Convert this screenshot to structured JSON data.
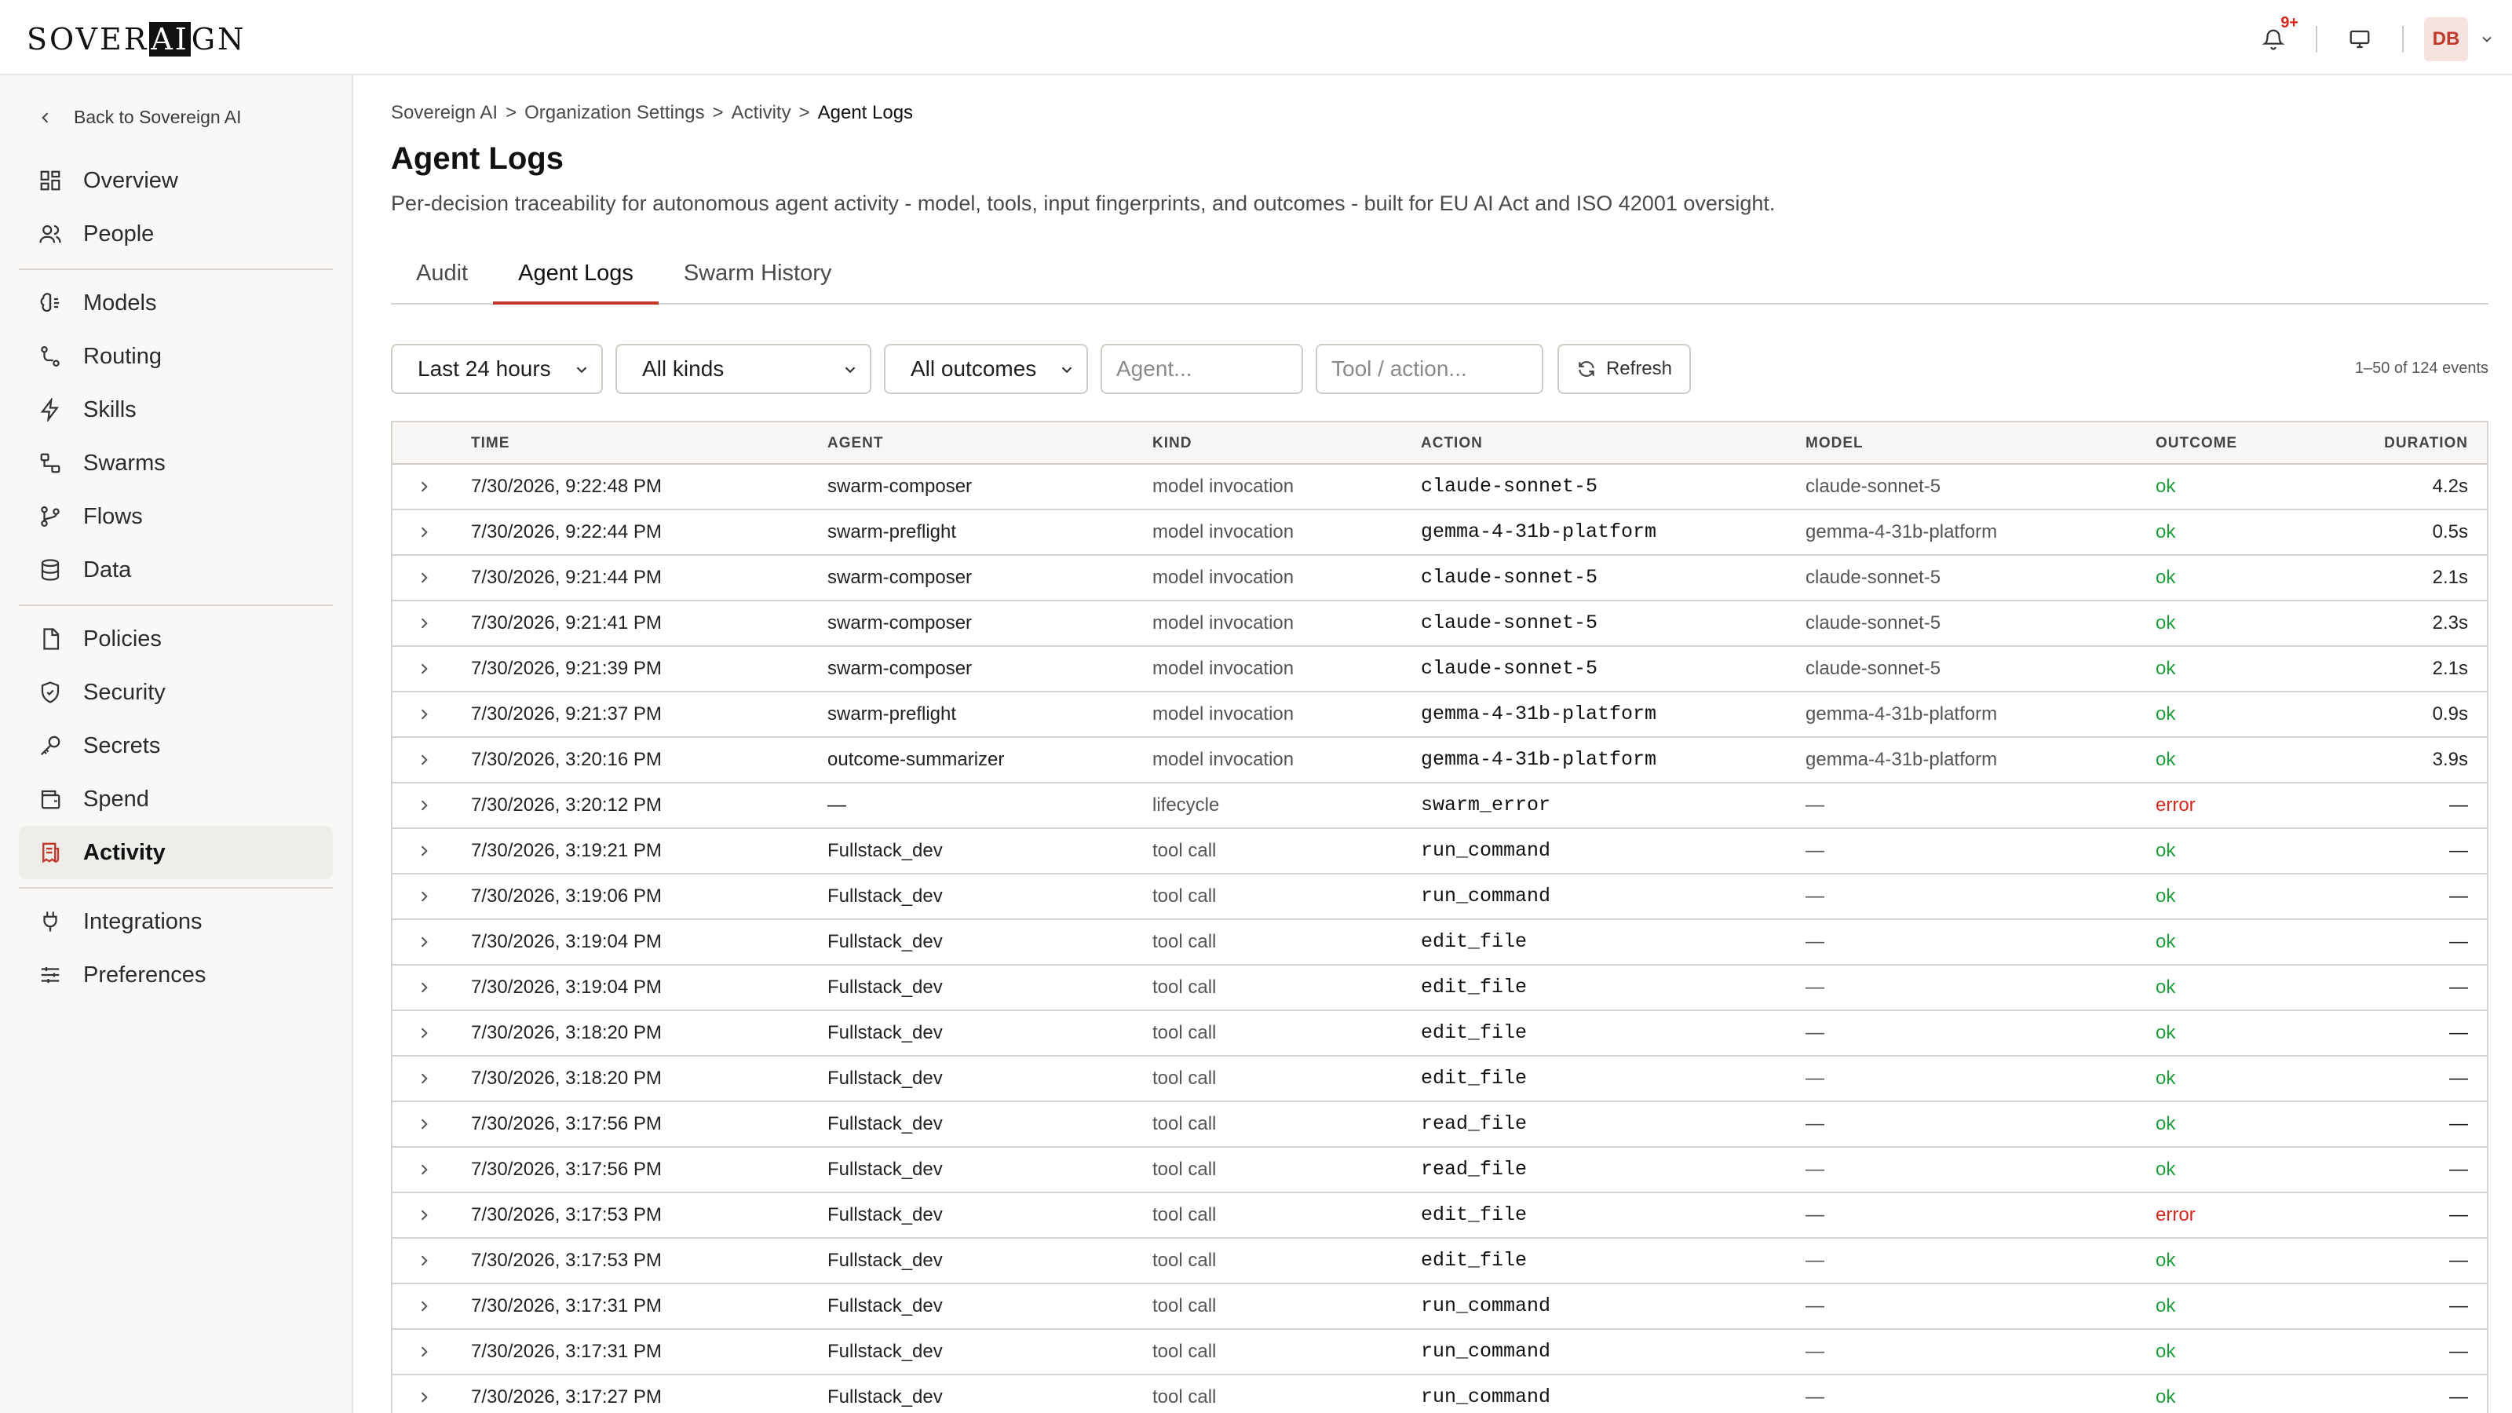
{
  "brand": {
    "logo_pre": "SOVER",
    "logo_hl": "AI",
    "logo_post": "GN"
  },
  "topbar": {
    "notifications_badge": "9+",
    "avatar_initials": "DB"
  },
  "sidebar": {
    "back_label": "Back to Sovereign AI",
    "groups": [
      [
        {
          "label": "Overview",
          "icon": "grid-icon"
        },
        {
          "label": "People",
          "icon": "people-icon"
        }
      ],
      [
        {
          "label": "Models",
          "icon": "brain-icon"
        },
        {
          "label": "Routing",
          "icon": "route-icon"
        },
        {
          "label": "Skills",
          "icon": "bolt-icon"
        },
        {
          "label": "Swarms",
          "icon": "swarm-icon"
        },
        {
          "label": "Flows",
          "icon": "flow-icon"
        },
        {
          "label": "Data",
          "icon": "database-icon"
        }
      ],
      [
        {
          "label": "Policies",
          "icon": "document-icon"
        },
        {
          "label": "Security",
          "icon": "shield-icon"
        },
        {
          "label": "Secrets",
          "icon": "key-icon"
        },
        {
          "label": "Spend",
          "icon": "wallet-icon"
        },
        {
          "label": "Activity",
          "icon": "receipt-icon",
          "active": true
        }
      ],
      [
        {
          "label": "Integrations",
          "icon": "plug-icon"
        },
        {
          "label": "Preferences",
          "icon": "sliders-icon"
        }
      ]
    ]
  },
  "breadcrumb": {
    "items": [
      "Sovereign AI",
      "Organization Settings",
      "Activity"
    ],
    "separator": ">",
    "current": "Agent Logs"
  },
  "page": {
    "title": "Agent Logs",
    "description": "Per-decision traceability for autonomous agent activity - model, tools, input fingerprints, and outcomes - built for EU AI Act and ISO 42001 oversight."
  },
  "tabs": [
    {
      "label": "Audit"
    },
    {
      "label": "Agent Logs",
      "active": true
    },
    {
      "label": "Swarm History"
    }
  ],
  "filters": {
    "time_range": "Last 24 hours",
    "kind": "All kinds",
    "outcome": "All outcomes",
    "agent_placeholder": "Agent...",
    "tool_placeholder": "Tool / action...",
    "refresh_label": "Refresh",
    "count_text": "1–50 of 124 events"
  },
  "table": {
    "columns": [
      "TIME",
      "AGENT",
      "KIND",
      "ACTION",
      "MODEL",
      "OUTCOME",
      "DURATION"
    ],
    "rows": [
      {
        "time": "7/30/2026, 9:22:48 PM",
        "agent": "swarm-composer",
        "kind": "model invocation",
        "action": "claude-sonnet-5",
        "model": "claude-sonnet-5",
        "outcome": "ok",
        "duration": "4.2s"
      },
      {
        "time": "7/30/2026, 9:22:44 PM",
        "agent": "swarm-preflight",
        "kind": "model invocation",
        "action": "gemma-4-31b-platform",
        "model": "gemma-4-31b-platform",
        "outcome": "ok",
        "duration": "0.5s"
      },
      {
        "time": "7/30/2026, 9:21:44 PM",
        "agent": "swarm-composer",
        "kind": "model invocation",
        "action": "claude-sonnet-5",
        "model": "claude-sonnet-5",
        "outcome": "ok",
        "duration": "2.1s"
      },
      {
        "time": "7/30/2026, 9:21:41 PM",
        "agent": "swarm-composer",
        "kind": "model invocation",
        "action": "claude-sonnet-5",
        "model": "claude-sonnet-5",
        "outcome": "ok",
        "duration": "2.3s"
      },
      {
        "time": "7/30/2026, 9:21:39 PM",
        "agent": "swarm-composer",
        "kind": "model invocation",
        "action": "claude-sonnet-5",
        "model": "claude-sonnet-5",
        "outcome": "ok",
        "duration": "2.1s"
      },
      {
        "time": "7/30/2026, 9:21:37 PM",
        "agent": "swarm-preflight",
        "kind": "model invocation",
        "action": "gemma-4-31b-platform",
        "model": "gemma-4-31b-platform",
        "outcome": "ok",
        "duration": "0.9s"
      },
      {
        "time": "7/30/2026, 3:20:16 PM",
        "agent": "outcome-summarizer",
        "kind": "model invocation",
        "action": "gemma-4-31b-platform",
        "model": "gemma-4-31b-platform",
        "outcome": "ok",
        "duration": "3.9s"
      },
      {
        "time": "7/30/2026, 3:20:12 PM",
        "agent": "—",
        "kind": "lifecycle",
        "action": "swarm_error",
        "model": "—",
        "outcome": "error",
        "duration": "—"
      },
      {
        "time": "7/30/2026, 3:19:21 PM",
        "agent": "Fullstack_dev",
        "kind": "tool call",
        "action": "run_command",
        "model": "—",
        "outcome": "ok",
        "duration": "—"
      },
      {
        "time": "7/30/2026, 3:19:06 PM",
        "agent": "Fullstack_dev",
        "kind": "tool call",
        "action": "run_command",
        "model": "—",
        "outcome": "ok",
        "duration": "—"
      },
      {
        "time": "7/30/2026, 3:19:04 PM",
        "agent": "Fullstack_dev",
        "kind": "tool call",
        "action": "edit_file",
        "model": "—",
        "outcome": "ok",
        "duration": "—"
      },
      {
        "time": "7/30/2026, 3:19:04 PM",
        "agent": "Fullstack_dev",
        "kind": "tool call",
        "action": "edit_file",
        "model": "—",
        "outcome": "ok",
        "duration": "—"
      },
      {
        "time": "7/30/2026, 3:18:20 PM",
        "agent": "Fullstack_dev",
        "kind": "tool call",
        "action": "edit_file",
        "model": "—",
        "outcome": "ok",
        "duration": "—"
      },
      {
        "time": "7/30/2026, 3:18:20 PM",
        "agent": "Fullstack_dev",
        "kind": "tool call",
        "action": "edit_file",
        "model": "—",
        "outcome": "ok",
        "duration": "—"
      },
      {
        "time": "7/30/2026, 3:17:56 PM",
        "agent": "Fullstack_dev",
        "kind": "tool call",
        "action": "read_file",
        "model": "—",
        "outcome": "ok",
        "duration": "—"
      },
      {
        "time": "7/30/2026, 3:17:56 PM",
        "agent": "Fullstack_dev",
        "kind": "tool call",
        "action": "read_file",
        "model": "—",
        "outcome": "ok",
        "duration": "—"
      },
      {
        "time": "7/30/2026, 3:17:53 PM",
        "agent": "Fullstack_dev",
        "kind": "tool call",
        "action": "edit_file",
        "model": "—",
        "outcome": "error",
        "duration": "—"
      },
      {
        "time": "7/30/2026, 3:17:53 PM",
        "agent": "Fullstack_dev",
        "kind": "tool call",
        "action": "edit_file",
        "model": "—",
        "outcome": "ok",
        "duration": "—"
      },
      {
        "time": "7/30/2026, 3:17:31 PM",
        "agent": "Fullstack_dev",
        "kind": "tool call",
        "action": "run_command",
        "model": "—",
        "outcome": "ok",
        "duration": "—"
      },
      {
        "time": "7/30/2026, 3:17:31 PM",
        "agent": "Fullstack_dev",
        "kind": "tool call",
        "action": "run_command",
        "model": "—",
        "outcome": "ok",
        "duration": "—"
      },
      {
        "time": "7/30/2026, 3:17:27 PM",
        "agent": "Fullstack_dev",
        "kind": "tool call",
        "action": "run_command",
        "model": "—",
        "outcome": "ok",
        "duration": "—"
      }
    ]
  },
  "colors": {
    "accent": "#c0392b",
    "ok": "#1e9e3a",
    "error": "#d9261c"
  }
}
